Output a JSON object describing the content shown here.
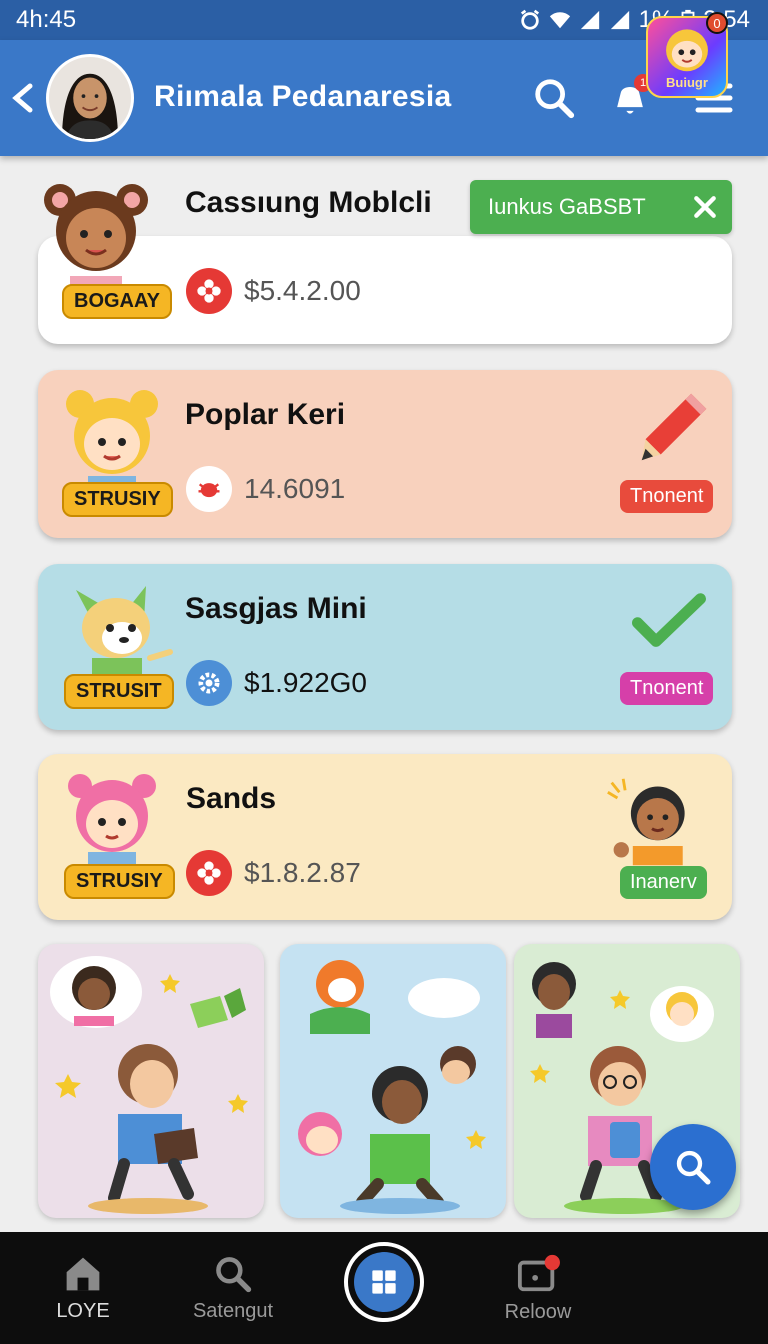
{
  "status_bar": {
    "time_left": "4h:45",
    "battery_percent": "1%",
    "time_right": "2:54"
  },
  "header": {
    "profile_name": "Riımala Pedanaresia",
    "notification_count": "1",
    "colors": {
      "bar": "#3a78c8",
      "status": "#2b5fa5"
    }
  },
  "toast": {
    "text": "Iunkus GaBSBT"
  },
  "cards": [
    {
      "title": "Cassıung Moblcli",
      "role": "BOGAAY",
      "amount": "$5.4.2.00",
      "bg": "#ffffff"
    },
    {
      "title": "Poplar Keri",
      "role": "STRUSIY",
      "amount": "14.6091",
      "status": "Tnonent",
      "status_color": "#e84b3c",
      "bg": "#f8d1bd"
    },
    {
      "title": "Sasgjas Mini",
      "role": "STRUSIT",
      "amount": "$1.922G0",
      "status": "Tnonent",
      "status_color": "#d63fa9",
      "bg": "#b5dde6"
    },
    {
      "title": "Sands",
      "role": "STRUSIY",
      "amount": "$1.8.2.87",
      "status": "Inanerv",
      "status_color": "#4caf50",
      "bg": "#fbe9c2"
    }
  ],
  "tiles": [
    {
      "bg": "#ecdfe9"
    },
    {
      "bg": "#c5e2f2"
    },
    {
      "bg": "#d9ecd3"
    }
  ],
  "bottom_nav": {
    "items": [
      {
        "label": "LOYE",
        "icon": "home-icon"
      },
      {
        "label": "Satengut",
        "icon": "search-icon"
      },
      {
        "label": "Reloow",
        "icon": "notification-box-icon"
      }
    ],
    "app_label": "Buiugr",
    "app_badge": "0"
  }
}
